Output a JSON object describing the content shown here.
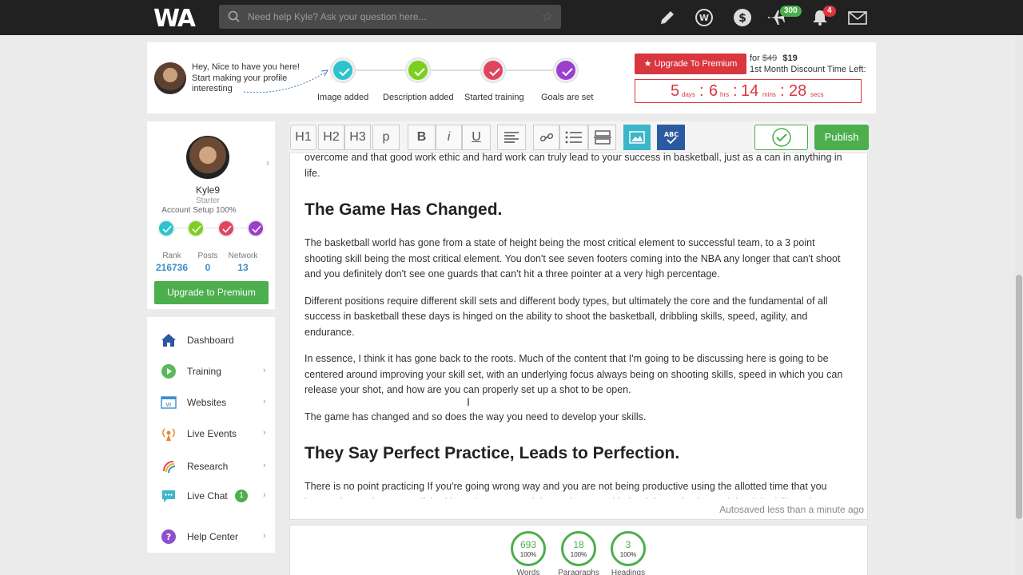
{
  "topbar": {
    "logo_text": "WA",
    "search_placeholder": "Need help Kyle? Ask your question here...",
    "badges": {
      "jet": "300",
      "bell": "4"
    }
  },
  "setup": {
    "greeting": "Hey, Nice to have you here! Start making your profile interesting",
    "steps": [
      {
        "label": "Image added",
        "color": "#2cc3cf"
      },
      {
        "label": "Description added",
        "color": "#7ccf1e"
      },
      {
        "label": "Started training",
        "color": "#e0455f"
      },
      {
        "label": "Goals are set",
        "color": "#9c3fcf"
      }
    ],
    "upgrade_label": "Upgrade To Premium",
    "price_for": "for",
    "old_price": "$49",
    "new_price": "$19",
    "discount_text": "1st Month Discount Time Left:",
    "timer": {
      "days": "5",
      "days_unit": "days",
      "hrs": "6",
      "hrs_unit": "hrs",
      "mins": "14",
      "mins_unit": "mins",
      "secs": "28",
      "secs_unit": "secs"
    }
  },
  "profile": {
    "username": "Kyle9",
    "plan": "Starter",
    "setup_text": "Account Setup 100%",
    "stats": [
      {
        "label": "Rank",
        "value": "216736"
      },
      {
        "label": "Posts",
        "value": "0"
      },
      {
        "label": "Network",
        "value": "13"
      }
    ],
    "upgrade_label": "Upgrade to Premium"
  },
  "nav": [
    {
      "label": "Dashboard"
    },
    {
      "label": "Training"
    },
    {
      "label": "Websites"
    },
    {
      "label": "Live Events"
    },
    {
      "label": "Research"
    },
    {
      "label": "Live Chat",
      "badge": "1"
    },
    {
      "label": "Help Center"
    }
  ],
  "editor": {
    "toolbar": {
      "h1": "H1",
      "h2": "H2",
      "h3": "H3",
      "p": "p",
      "bold": "B",
      "italic": "i",
      "underline": "U",
      "publish_label": "Publish"
    },
    "paragraphs": {
      "p0": "overcome and that good work ethic and hard work can truly lead to your success in basketball, just as a can in anything in life.",
      "h_game": "The Game Has Changed.",
      "p1": "The basketball world has gone from a state of height being the most critical element to successful team, to a 3 point shooting skill being the most critical element. You don't see seven footers coming into the NBA any longer that can't shoot and you definitely don't see one guards that can't hit a three pointer at a very high percentage.",
      "p2": "Different positions require different skill sets and different body types, but ultimately the core and the fundamental of all success in basketball these days is hinged on the ability to shoot the basketball, dribbling skills, speed, agility, and endurance.",
      "p3": "In essence, I think it has gone back to the roots. Much of the content that I'm going to be discussing here is going to be centered around improving your skill set, with an underlying focus always being on shooting skills, speed in which you can release your shot, and how are you can properly set up a shot to be open.",
      "p4": "The game has changed and so does the way you need to develop your skills.",
      "h_practice": "They Say Perfect Practice, Leads to Perfection.",
      "p5": "There is no point practicing If you're going wrong way and you are not being productive using the allotted time that you have. A lot can be accomplished in an hour or two sitting at the gym with the right motivation and the right drills and"
    },
    "autosave": "Autosaved less than a minute ago"
  },
  "stats_panel": [
    {
      "value": "693",
      "percent": "100%",
      "label": "Words"
    },
    {
      "value": "18",
      "percent": "100%",
      "label": "Paragraphs"
    },
    {
      "value": "3",
      "percent": "100%",
      "label": "Headings"
    }
  ],
  "colors": {
    "topbar": "#212121",
    "accent_green": "#4cae4c",
    "accent_red": "#d9363e",
    "link_blue": "#3d8fc6"
  }
}
